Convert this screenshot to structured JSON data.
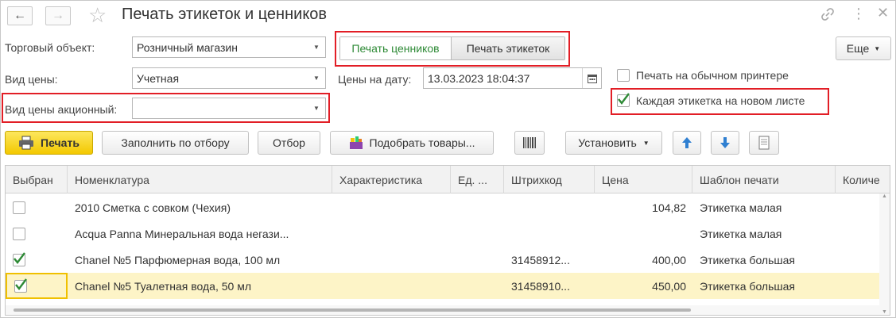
{
  "window": {
    "title": "Печать этикеток и ценников"
  },
  "form": {
    "trade_object_label": "Торговый объект:",
    "trade_object_value": "Розничный магазин",
    "price_type_label": "Вид цены:",
    "price_type_value": "Учетная",
    "promo_price_label": "Вид цены акционный:",
    "promo_price_value": "",
    "price_date_label": "Цены на дату:",
    "price_date_value": "13.03.2023 18:04:37",
    "mode_tabs": [
      "Печать ценников",
      "Печать этикеток"
    ],
    "plain_printer_label": "Печать на обычном принтере",
    "plain_printer_checked": false,
    "new_sheet_label": "Каждая этикетка на новом листе",
    "new_sheet_checked": true,
    "more_label": "Еще"
  },
  "toolbar": {
    "print_label": "Печать",
    "fill_label": "Заполнить по отбору",
    "filter_label": "Отбор",
    "pick_label": "Подобрать товары...",
    "set_label": "Установить"
  },
  "table": {
    "columns": [
      "Выбран",
      "Номенклатура",
      "Характеристика",
      "Ед. ...",
      "Штрихкод",
      "Цена",
      "Шаблон печати",
      "Количе"
    ],
    "rows": [
      {
        "checked": false,
        "name": "2010 Сметка с совком (Чехия)",
        "characteristic": "",
        "unit": "",
        "barcode": "",
        "price": "104,82",
        "template": "Этикетка малая"
      },
      {
        "checked": false,
        "name": "Acqua Panna Минеральная вода негази...",
        "characteristic": "",
        "unit": "",
        "barcode": "",
        "price": "",
        "template": "Этикетка малая"
      },
      {
        "checked": true,
        "name": "Chanel №5 Парфюмерная вода, 100 мл",
        "characteristic": "",
        "unit": "",
        "barcode": "31458912...",
        "price": "400,00",
        "template": "Этикетка большая"
      },
      {
        "checked": true,
        "name": "Chanel №5 Туалетная вода, 50 мл",
        "characteristic": "",
        "unit": "",
        "barcode": "31458910...",
        "price": "450,00",
        "template": "Этикетка большая"
      }
    ]
  },
  "colors": {
    "highlight": "#e21e26",
    "accent_green": "#2e8a36",
    "print_button": "#f6cd00",
    "selected_row": "#fdf4c7"
  }
}
